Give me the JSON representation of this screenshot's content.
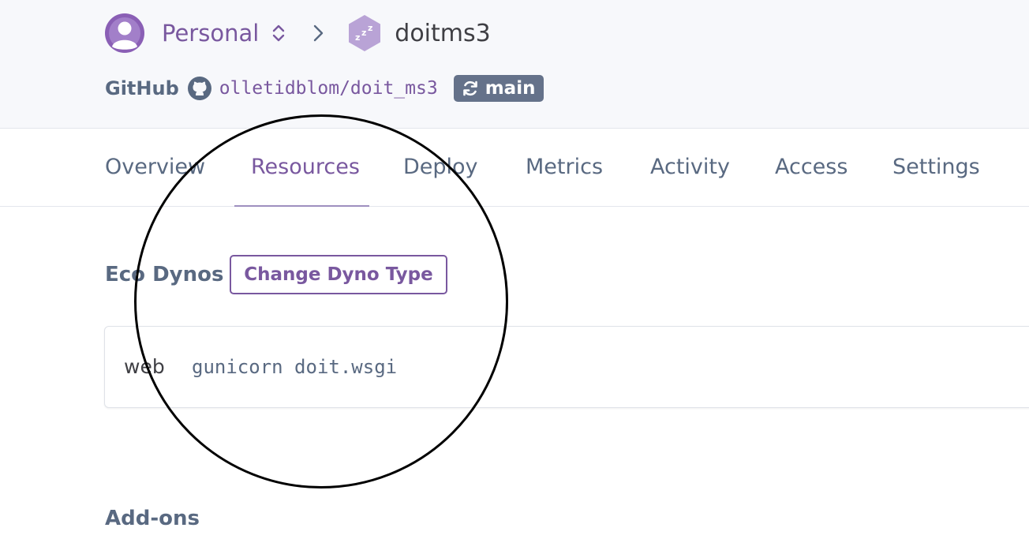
{
  "header": {
    "org_name": "Personal",
    "app_name": "doitms3",
    "source_label": "GitHub",
    "repo": "olletidblom/doit_ms3",
    "branch": "main"
  },
  "tabs": [
    {
      "label": "Overview",
      "active": false
    },
    {
      "label": "Resources",
      "active": true
    },
    {
      "label": "Deploy",
      "active": false
    },
    {
      "label": "Metrics",
      "active": false
    },
    {
      "label": "Activity",
      "active": false
    },
    {
      "label": "Access",
      "active": false
    },
    {
      "label": "Settings",
      "active": false
    }
  ],
  "dynos": {
    "title": "Eco Dynos",
    "change_button": "Change Dyno Type",
    "items": [
      {
        "type": "web",
        "command": "gunicorn doit.wsgi"
      }
    ]
  },
  "addons": {
    "title": "Add-ons"
  },
  "colors": {
    "accent": "#79589f",
    "header_bg": "#f7f8fb",
    "muted_text": "#596981",
    "branch_badge": "#65728a"
  }
}
